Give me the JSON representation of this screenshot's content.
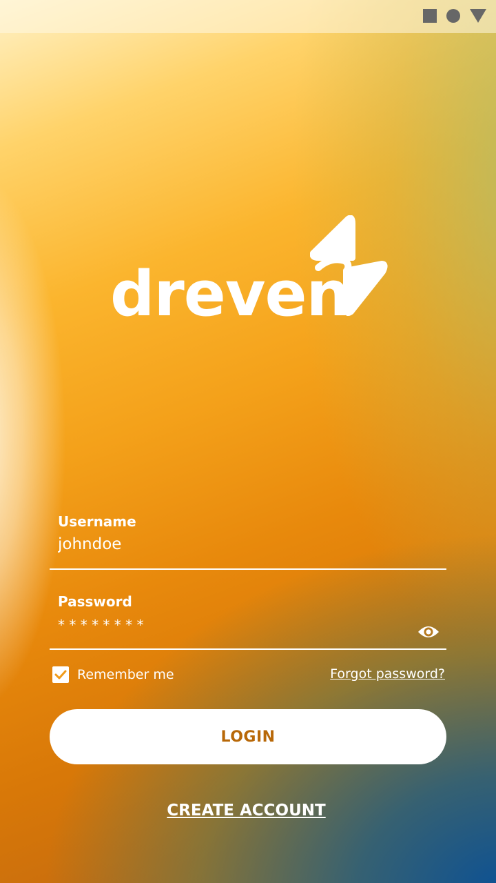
{
  "status_bar": {
    "icons": [
      "stop-square-icon",
      "record-circle-icon",
      "signal-triangle-icon"
    ]
  },
  "logo": {
    "text": "dreven",
    "icon": "lightning-bolt-icon"
  },
  "username": {
    "label": "Username",
    "value": "johndoe"
  },
  "password": {
    "label": "Password",
    "value": "* * * * * * * *",
    "toggle_icon": "eye-icon"
  },
  "remember_me": {
    "label": "Remember me",
    "checked": true
  },
  "forgot_password": {
    "label": "Forgot password?"
  },
  "login_button": {
    "label": "LOGIN"
  },
  "create_account": {
    "label": "CREATE ACCOUNT"
  },
  "colors": {
    "accent": "#f4a11a",
    "button_text": "#b86808",
    "text": "#ffffff"
  }
}
